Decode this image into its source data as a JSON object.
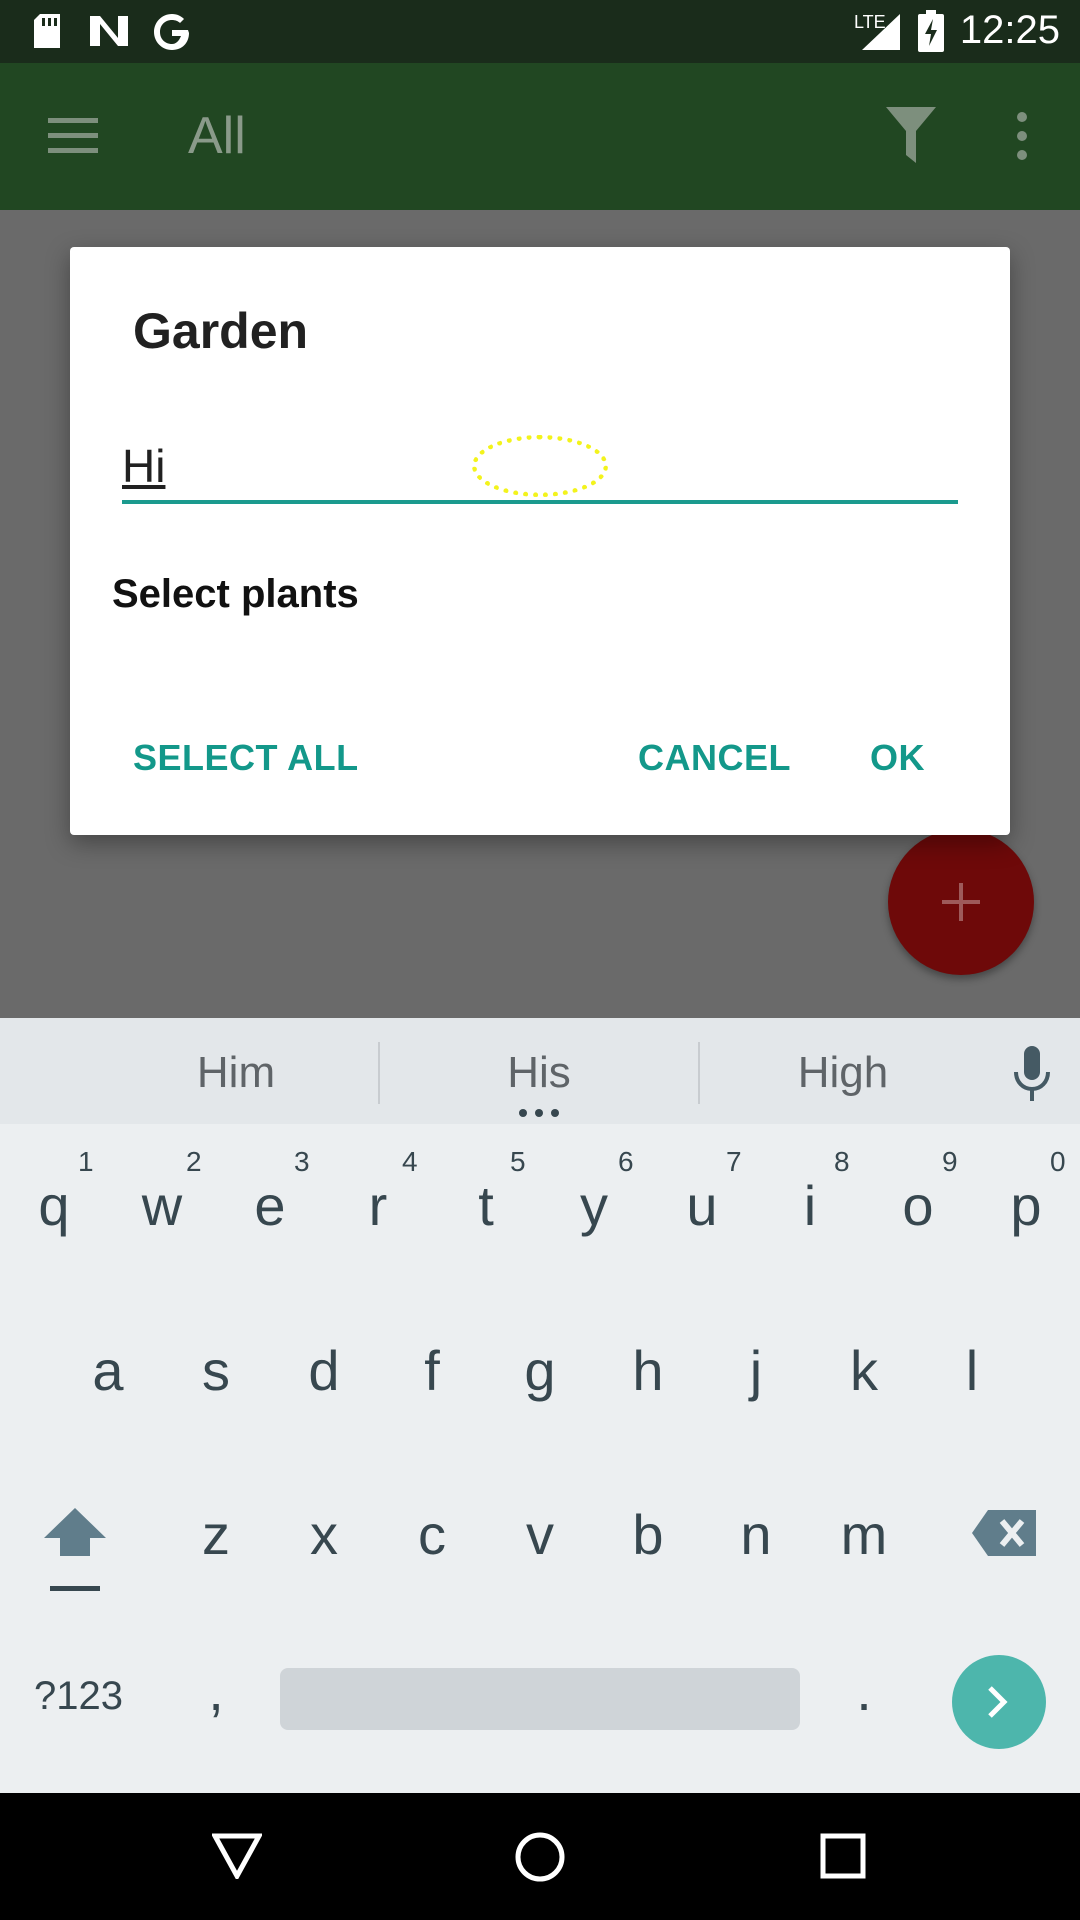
{
  "status_bar": {
    "time": "12:25",
    "network": "LTE",
    "icons": [
      "sd-card-icon",
      "n-notification-icon",
      "google-icon",
      "signal-icon",
      "battery-charging-icon"
    ]
  },
  "app_bar": {
    "title": "All",
    "icons": [
      "menu-icon",
      "filter-icon",
      "more-vert-icon"
    ]
  },
  "dialog": {
    "title": "Garden",
    "input_value": "Hi",
    "section_label": "Select plants",
    "buttons": {
      "select_all": "SELECT ALL",
      "cancel": "CANCEL",
      "ok": "OK"
    }
  },
  "fab": {
    "icon": "plus-icon"
  },
  "keyboard": {
    "suggestions": [
      "Him",
      "His",
      "High"
    ],
    "row1": [
      "q",
      "w",
      "e",
      "r",
      "t",
      "y",
      "u",
      "i",
      "o",
      "p"
    ],
    "row1_nums": [
      "1",
      "2",
      "3",
      "4",
      "5",
      "6",
      "7",
      "8",
      "9",
      "0"
    ],
    "row2": [
      "a",
      "s",
      "d",
      "f",
      "g",
      "h",
      "j",
      "k",
      "l"
    ],
    "row3": [
      "z",
      "x",
      "c",
      "v",
      "b",
      "n",
      "m"
    ],
    "symbols_label": "?123",
    "comma": ",",
    "period": "."
  },
  "colors": {
    "app_bar": "#214722",
    "status_bar": "#1a2c1b",
    "accent": "#13988a",
    "fab": "#6e0909",
    "enter_key": "#4db6ac"
  }
}
